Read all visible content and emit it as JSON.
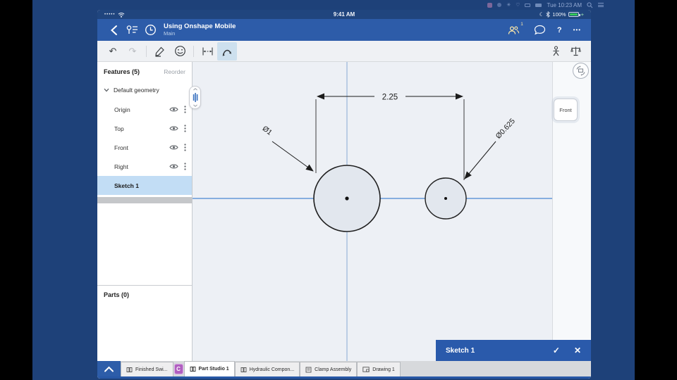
{
  "menubar": {
    "time": "Tue 10:23 AM"
  },
  "status_bar": {
    "time": "9:41 AM",
    "battery": "100%"
  },
  "header": {
    "title": "Using Onshape Mobile",
    "subtitle": "Main",
    "collab_badge": "1",
    "help_label": "?",
    "more_label": "•••"
  },
  "features_panel": {
    "title": "Features (5)",
    "reorder_label": "Reorder",
    "group_label": "Default geometry",
    "items": [
      {
        "label": "Origin"
      },
      {
        "label": "Top"
      },
      {
        "label": "Front"
      },
      {
        "label": "Right"
      }
    ],
    "sketch_item": "Sketch 1"
  },
  "parts_panel": {
    "title": "Parts (0)"
  },
  "canvas": {
    "dim_linear": "2.25",
    "dim_big_circle": "Ø1",
    "dim_small_circle": "Ø0.625",
    "view_cube_label": "Front"
  },
  "sketch_dialog": {
    "title": "Sketch 1",
    "confirm": "✓",
    "cancel": "✕"
  },
  "tab_bar": {
    "collaborator_initial": "C",
    "tabs": [
      {
        "label": "Finished Swi..."
      },
      {
        "label": "Part Studio 1"
      },
      {
        "label": "Hydraulic Compon..."
      },
      {
        "label": "Clamp Assembly"
      },
      {
        "label": "Drawing 1"
      }
    ]
  },
  "colors": {
    "header_blue": "#2d5ca9",
    "dialog_blue": "#2a5aab",
    "selection_blue": "#c2ddf5",
    "construction_line": "#4a86d2",
    "battery_green": "#35c759"
  }
}
